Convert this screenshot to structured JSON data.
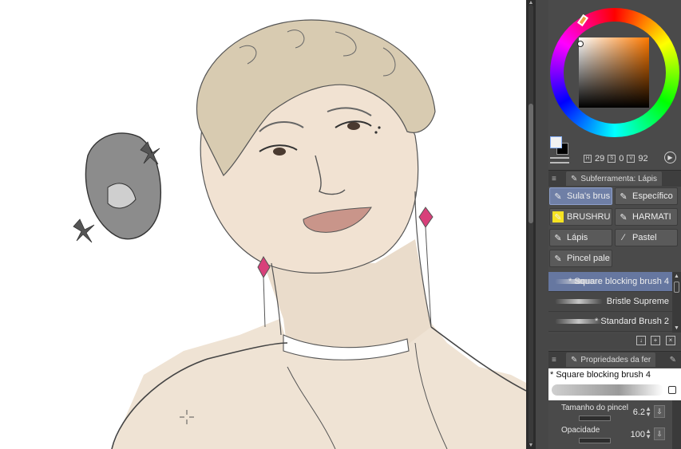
{
  "colors": {
    "canvas_bg": "#ffffff",
    "panel_bg": "#4a4a4a",
    "active_highlight": "#6f7fa6",
    "skin": "#efe0d0",
    "hair": "#d5c7ad",
    "earring": "#d8407a"
  },
  "color_picker": {
    "hsv": [
      {
        "label": "H",
        "value": "29"
      },
      {
        "label": "S",
        "value": "0"
      },
      {
        "label": "V",
        "value": "92"
      }
    ]
  },
  "subtool_panel": {
    "tab_label": "Subferramenta: Lápis",
    "groups": [
      {
        "label": "Sula's brus",
        "icon": "pen-icon",
        "active": true
      },
      {
        "label": "Específico",
        "icon": "pen-icon",
        "active": false
      },
      {
        "label": "BRUSHRU",
        "icon": "yellow-brush-icon",
        "active": false
      },
      {
        "label": "HARMATI",
        "icon": "pen-icon",
        "active": false
      },
      {
        "label": "Lápis",
        "icon": "pencil-icon",
        "active": false
      },
      {
        "label": "Pastel",
        "icon": "pastel-icon",
        "active": false
      },
      {
        "label": "Pincel pale",
        "icon": "pen-icon",
        "active": false
      }
    ],
    "brushes": [
      {
        "label": "* Square blocking brush 4",
        "active": true
      },
      {
        "label": "Bristle Supreme",
        "active": false
      },
      {
        "label": "* Standard Brush 2",
        "active": false
      }
    ]
  },
  "tool_property": {
    "tab_label": "Propriedades da fer",
    "brush_name": "* Square blocking brush 4",
    "brush_size": {
      "label": "Tamanho do pincel",
      "value": "6.2"
    },
    "opacity": {
      "label": "Opacidade",
      "value": "100"
    }
  }
}
